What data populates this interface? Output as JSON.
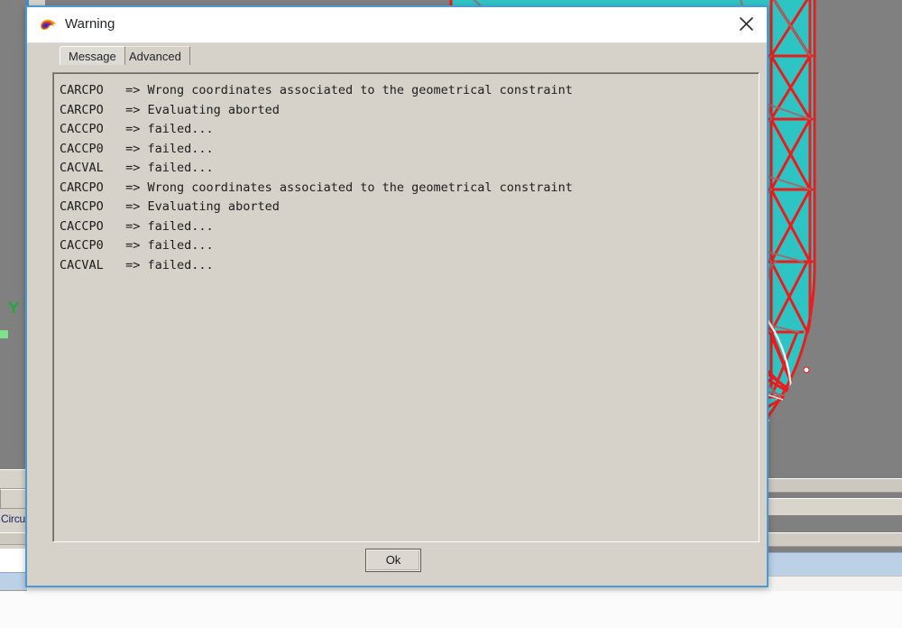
{
  "background": {
    "name": "cad-3d-viewport",
    "viewport_bg_color": "#808080",
    "mesh_fill_color": "#2fc4c4",
    "mesh_edge_color": "#ea1c1c",
    "mesh_wire_color": "#9a6a6a",
    "highlight_curve_color": "#ffffff",
    "panel_label": "Circuit",
    "warning_marker": "warning-triangle-icon",
    "axis_marker_label": "Y",
    "accent_blue": "#3b8fd1"
  },
  "dialog": {
    "title": "Warning",
    "app_icon": "shrimp-logo-icon",
    "close_icon": "close-icon",
    "border_color": "#4a9ad4",
    "titlebar_bg": "#ffffff",
    "body_bg": "#d6d2ca",
    "tabs": [
      {
        "label": "Message",
        "selected": true
      },
      {
        "label": "Advanced",
        "selected": false
      }
    ],
    "log_lines": [
      "CARCPO   => Wrong coordinates associated to the geometrical constraint",
      "CARCPO   => Evaluating aborted",
      "CACCPO   => failed...",
      "CACCP0   => failed...",
      "CACVAL   => failed...",
      "CARCPO   => Wrong coordinates associated to the geometrical constraint",
      "CARCPO   => Evaluating aborted",
      "CACCPO   => failed...",
      "CACCP0   => failed...",
      "CACVAL   => failed..."
    ],
    "buttons": {
      "ok_label": "Ok"
    }
  }
}
